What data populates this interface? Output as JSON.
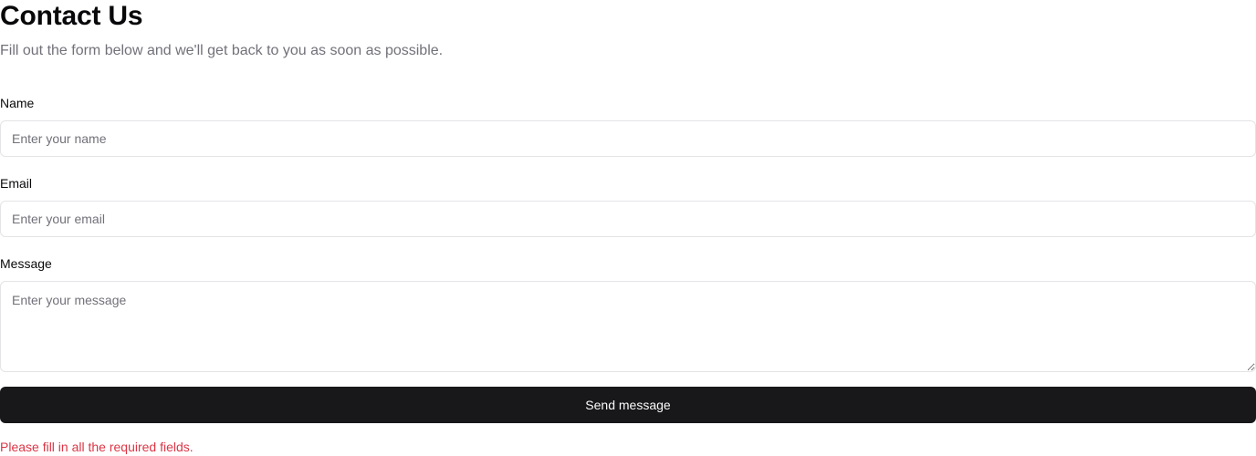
{
  "header": {
    "title": "Contact Us",
    "subtitle": "Fill out the form below and we'll get back to you as soon as possible."
  },
  "form": {
    "name": {
      "label": "Name",
      "value": "",
      "placeholder": "Enter your name"
    },
    "email": {
      "label": "Email",
      "value": "",
      "placeholder": "Enter your email"
    },
    "message": {
      "label": "Message",
      "value": "",
      "placeholder": "Enter your message"
    },
    "submit_label": "Send message",
    "error_text": "Please fill in all the required fields."
  },
  "colors": {
    "button_background": "#18181b",
    "button_text": "#fafafa",
    "error": "#dc3545",
    "muted_text": "#71717a",
    "border": "#e4e4e7"
  }
}
